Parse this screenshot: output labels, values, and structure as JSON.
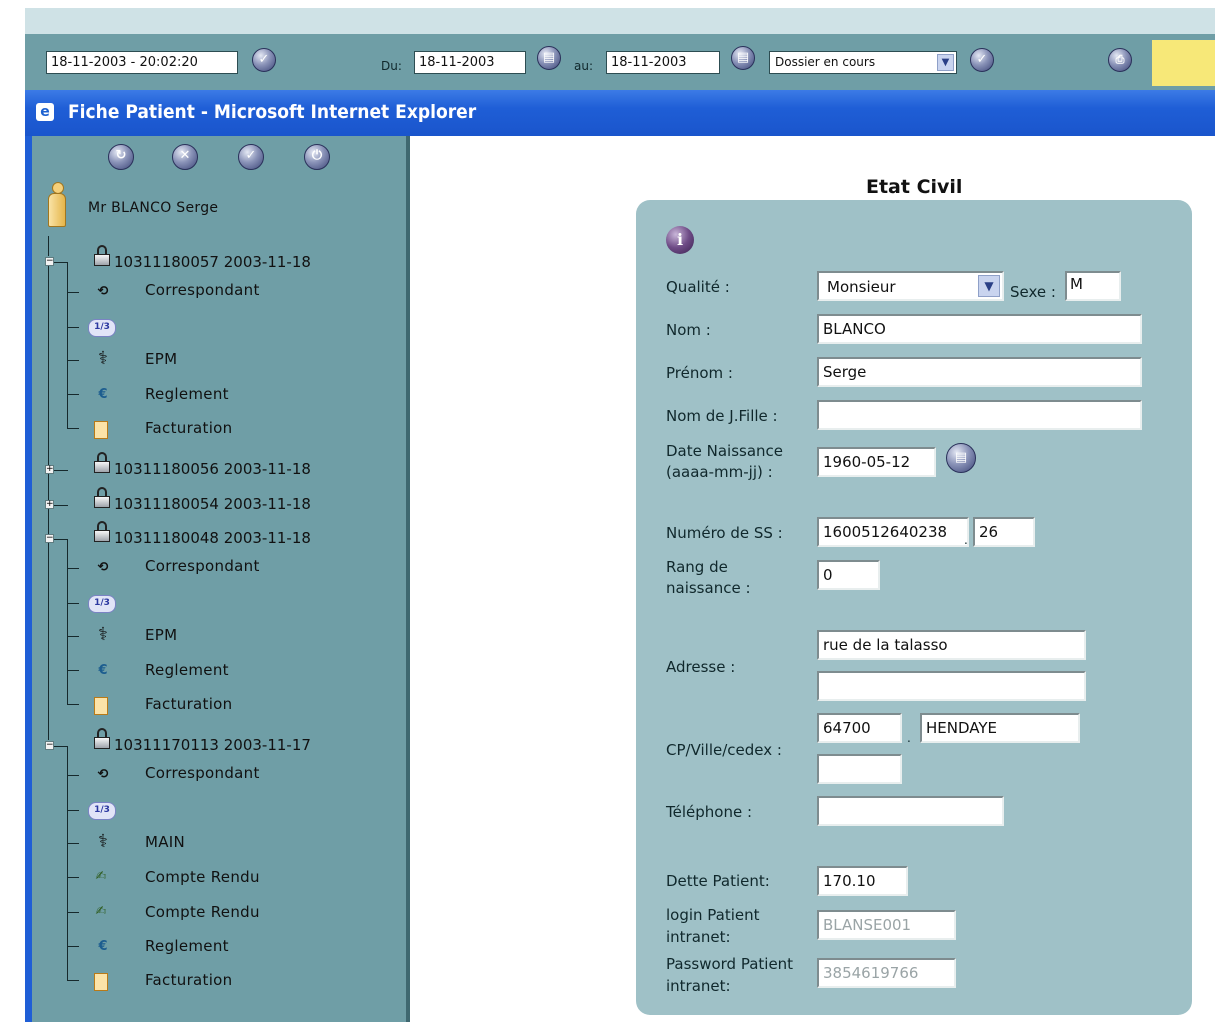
{
  "toolbar": {
    "datetime_value": "18-11-2003 - 20:02:20",
    "du_label": "Du:",
    "du_value": "18-11-2003",
    "au_label": "au:",
    "au_value": "18-11-2003",
    "dossier_select": "Dossier en cours"
  },
  "window": {
    "title": "Fiche Patient - Microsoft Internet Explorer"
  },
  "sidebar": {
    "patient_name": "Mr BLANCO Serge",
    "dossiers": [
      {
        "label": "10311180057 2003-11-18",
        "expanded": true,
        "children": [
          "Correspondant",
          "1/3",
          "EPM",
          "Reglement",
          "Facturation"
        ]
      },
      {
        "label": "10311180056 2003-11-18",
        "expanded": false
      },
      {
        "label": "10311180054 2003-11-18",
        "expanded": false
      },
      {
        "label": "10311180048 2003-11-18",
        "expanded": true,
        "children": [
          "Correspondant",
          "1/3",
          "EPM",
          "Reglement",
          "Facturation"
        ]
      },
      {
        "label": "10311170113 2003-11-17",
        "expanded": true,
        "children": [
          "Correspondant",
          "1/3",
          "MAIN",
          "Compte Rendu",
          "Compte Rendu",
          "Reglement",
          "Facturation"
        ]
      }
    ]
  },
  "form": {
    "section_title": "Etat Civil",
    "qualite_label": "Qualité :",
    "qualite_value": "Monsieur",
    "sexe_label": "Sexe :",
    "sexe_value": "M",
    "nom_label": "Nom :",
    "nom_value": "BLANCO",
    "prenom_label": "Prénom :",
    "prenom_value": "Serge",
    "nom_jfille_label": "Nom de J.Fille :",
    "nom_jfille_value": "",
    "date_naissance_label_1": "Date Naissance",
    "date_naissance_label_2": "(aaaa-mm-jj) :",
    "date_naissance_value": "1960-05-12",
    "numero_ss_label": "Numéro de SS :",
    "numero_ss_value": "1600512640238",
    "numero_ss_key": "26",
    "rang_label_1": "Rang de",
    "rang_label_2": "naissance :",
    "rang_value": "0",
    "adresse_label": "Adresse :",
    "adresse_line1": "rue de la talasso",
    "adresse_line2": "",
    "cp_label": "CP/Ville/cedex :",
    "cp_value": "64700",
    "ville_value": "HENDAYE",
    "cedex_value": "",
    "telephone_label": "Téléphone :",
    "telephone_value": "",
    "dette_label": "Dette Patient:",
    "dette_value": "170.10",
    "login_label_1": "login Patient",
    "login_label_2": "intranet:",
    "login_value": "BLANSE001",
    "password_label_1": "Password Patient",
    "password_label_2": "intranet:",
    "password_value": "3854619766"
  }
}
